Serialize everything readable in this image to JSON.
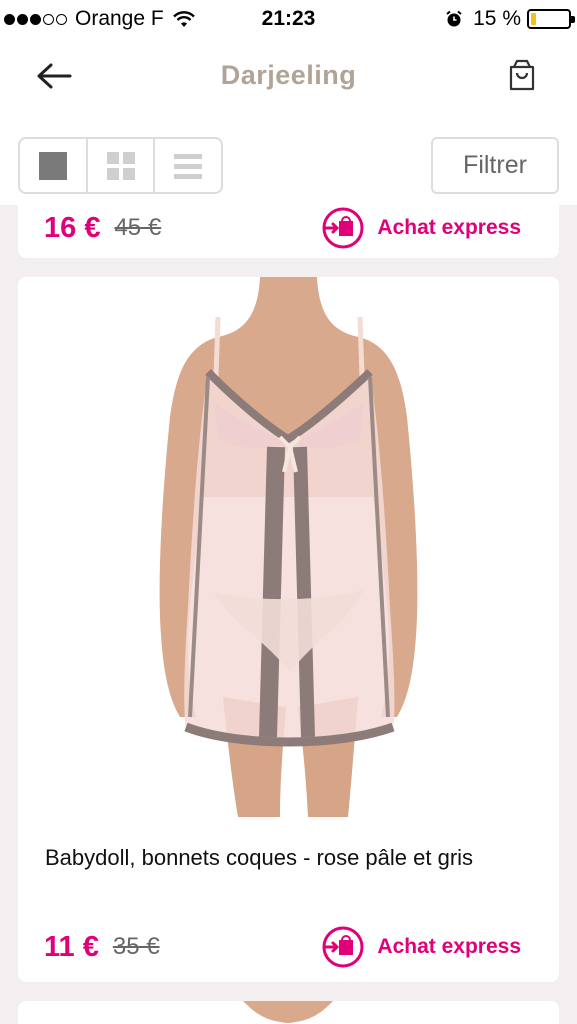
{
  "status_bar": {
    "carrier": "Orange F",
    "time": "21:23",
    "battery": "15 %",
    "battery_level": 0.15
  },
  "header": {
    "brand": "Darjeeling",
    "back_icon": "arrow-left-icon",
    "cart_icon": "shopping-bag-icon"
  },
  "toolbar": {
    "views": [
      "single-view-icon",
      "grid-view-icon",
      "list-view-icon"
    ],
    "active_view": "single",
    "filter_label": "Filtrer"
  },
  "products": [
    {
      "price": "16 €",
      "old_price": "45 €",
      "express_label": "Achat express"
    },
    {
      "title": "Babydoll, bonnets coques - rose pâle et gris",
      "price": "11 €",
      "old_price": "35 €",
      "express_label": "Achat express"
    }
  ],
  "colors": {
    "accent": "#e0007a",
    "brand": "#b1a497",
    "background": "#f3eef0"
  }
}
